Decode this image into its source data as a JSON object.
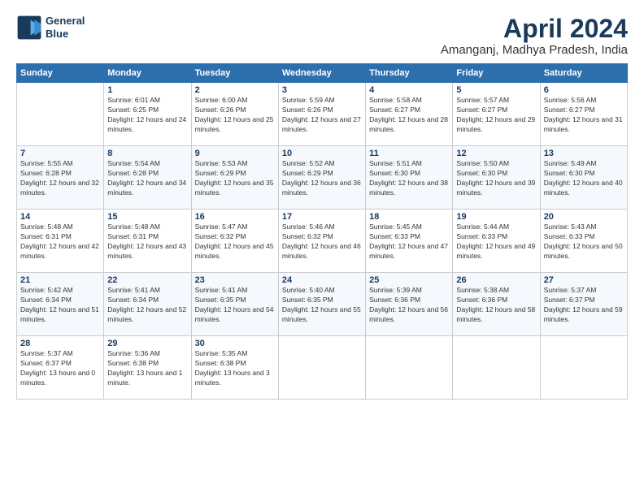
{
  "logo": {
    "line1": "General",
    "line2": "Blue"
  },
  "title": "April 2024",
  "location": "Amanganj, Madhya Pradesh, India",
  "days_of_week": [
    "Sunday",
    "Monday",
    "Tuesday",
    "Wednesday",
    "Thursday",
    "Friday",
    "Saturday"
  ],
  "weeks": [
    [
      {
        "num": "",
        "sunrise": "",
        "sunset": "",
        "daylight": ""
      },
      {
        "num": "1",
        "sunrise": "Sunrise: 6:01 AM",
        "sunset": "Sunset: 6:25 PM",
        "daylight": "Daylight: 12 hours and 24 minutes."
      },
      {
        "num": "2",
        "sunrise": "Sunrise: 6:00 AM",
        "sunset": "Sunset: 6:26 PM",
        "daylight": "Daylight: 12 hours and 25 minutes."
      },
      {
        "num": "3",
        "sunrise": "Sunrise: 5:59 AM",
        "sunset": "Sunset: 6:26 PM",
        "daylight": "Daylight: 12 hours and 27 minutes."
      },
      {
        "num": "4",
        "sunrise": "Sunrise: 5:58 AM",
        "sunset": "Sunset: 6:27 PM",
        "daylight": "Daylight: 12 hours and 28 minutes."
      },
      {
        "num": "5",
        "sunrise": "Sunrise: 5:57 AM",
        "sunset": "Sunset: 6:27 PM",
        "daylight": "Daylight: 12 hours and 29 minutes."
      },
      {
        "num": "6",
        "sunrise": "Sunrise: 5:56 AM",
        "sunset": "Sunset: 6:27 PM",
        "daylight": "Daylight: 12 hours and 31 minutes."
      }
    ],
    [
      {
        "num": "7",
        "sunrise": "Sunrise: 5:55 AM",
        "sunset": "Sunset: 6:28 PM",
        "daylight": "Daylight: 12 hours and 32 minutes."
      },
      {
        "num": "8",
        "sunrise": "Sunrise: 5:54 AM",
        "sunset": "Sunset: 6:28 PM",
        "daylight": "Daylight: 12 hours and 34 minutes."
      },
      {
        "num": "9",
        "sunrise": "Sunrise: 5:53 AM",
        "sunset": "Sunset: 6:29 PM",
        "daylight": "Daylight: 12 hours and 35 minutes."
      },
      {
        "num": "10",
        "sunrise": "Sunrise: 5:52 AM",
        "sunset": "Sunset: 6:29 PM",
        "daylight": "Daylight: 12 hours and 36 minutes."
      },
      {
        "num": "11",
        "sunrise": "Sunrise: 5:51 AM",
        "sunset": "Sunset: 6:30 PM",
        "daylight": "Daylight: 12 hours and 38 minutes."
      },
      {
        "num": "12",
        "sunrise": "Sunrise: 5:50 AM",
        "sunset": "Sunset: 6:30 PM",
        "daylight": "Daylight: 12 hours and 39 minutes."
      },
      {
        "num": "13",
        "sunrise": "Sunrise: 5:49 AM",
        "sunset": "Sunset: 6:30 PM",
        "daylight": "Daylight: 12 hours and 40 minutes."
      }
    ],
    [
      {
        "num": "14",
        "sunrise": "Sunrise: 5:48 AM",
        "sunset": "Sunset: 6:31 PM",
        "daylight": "Daylight: 12 hours and 42 minutes."
      },
      {
        "num": "15",
        "sunrise": "Sunrise: 5:48 AM",
        "sunset": "Sunset: 6:31 PM",
        "daylight": "Daylight: 12 hours and 43 minutes."
      },
      {
        "num": "16",
        "sunrise": "Sunrise: 5:47 AM",
        "sunset": "Sunset: 6:32 PM",
        "daylight": "Daylight: 12 hours and 45 minutes."
      },
      {
        "num": "17",
        "sunrise": "Sunrise: 5:46 AM",
        "sunset": "Sunset: 6:32 PM",
        "daylight": "Daylight: 12 hours and 46 minutes."
      },
      {
        "num": "18",
        "sunrise": "Sunrise: 5:45 AM",
        "sunset": "Sunset: 6:33 PM",
        "daylight": "Daylight: 12 hours and 47 minutes."
      },
      {
        "num": "19",
        "sunrise": "Sunrise: 5:44 AM",
        "sunset": "Sunset: 6:33 PM",
        "daylight": "Daylight: 12 hours and 49 minutes."
      },
      {
        "num": "20",
        "sunrise": "Sunrise: 5:43 AM",
        "sunset": "Sunset: 6:33 PM",
        "daylight": "Daylight: 12 hours and 50 minutes."
      }
    ],
    [
      {
        "num": "21",
        "sunrise": "Sunrise: 5:42 AM",
        "sunset": "Sunset: 6:34 PM",
        "daylight": "Daylight: 12 hours and 51 minutes."
      },
      {
        "num": "22",
        "sunrise": "Sunrise: 5:41 AM",
        "sunset": "Sunset: 6:34 PM",
        "daylight": "Daylight: 12 hours and 52 minutes."
      },
      {
        "num": "23",
        "sunrise": "Sunrise: 5:41 AM",
        "sunset": "Sunset: 6:35 PM",
        "daylight": "Daylight: 12 hours and 54 minutes."
      },
      {
        "num": "24",
        "sunrise": "Sunrise: 5:40 AM",
        "sunset": "Sunset: 6:35 PM",
        "daylight": "Daylight: 12 hours and 55 minutes."
      },
      {
        "num": "25",
        "sunrise": "Sunrise: 5:39 AM",
        "sunset": "Sunset: 6:36 PM",
        "daylight": "Daylight: 12 hours and 56 minutes."
      },
      {
        "num": "26",
        "sunrise": "Sunrise: 5:38 AM",
        "sunset": "Sunset: 6:36 PM",
        "daylight": "Daylight: 12 hours and 58 minutes."
      },
      {
        "num": "27",
        "sunrise": "Sunrise: 5:37 AM",
        "sunset": "Sunset: 6:37 PM",
        "daylight": "Daylight: 12 hours and 59 minutes."
      }
    ],
    [
      {
        "num": "28",
        "sunrise": "Sunrise: 5:37 AM",
        "sunset": "Sunset: 6:37 PM",
        "daylight": "Daylight: 13 hours and 0 minutes."
      },
      {
        "num": "29",
        "sunrise": "Sunrise: 5:36 AM",
        "sunset": "Sunset: 6:38 PM",
        "daylight": "Daylight: 13 hours and 1 minute."
      },
      {
        "num": "30",
        "sunrise": "Sunrise: 5:35 AM",
        "sunset": "Sunset: 6:38 PM",
        "daylight": "Daylight: 13 hours and 3 minutes."
      },
      {
        "num": "",
        "sunrise": "",
        "sunset": "",
        "daylight": ""
      },
      {
        "num": "",
        "sunrise": "",
        "sunset": "",
        "daylight": ""
      },
      {
        "num": "",
        "sunrise": "",
        "sunset": "",
        "daylight": ""
      },
      {
        "num": "",
        "sunrise": "",
        "sunset": "",
        "daylight": ""
      }
    ]
  ]
}
